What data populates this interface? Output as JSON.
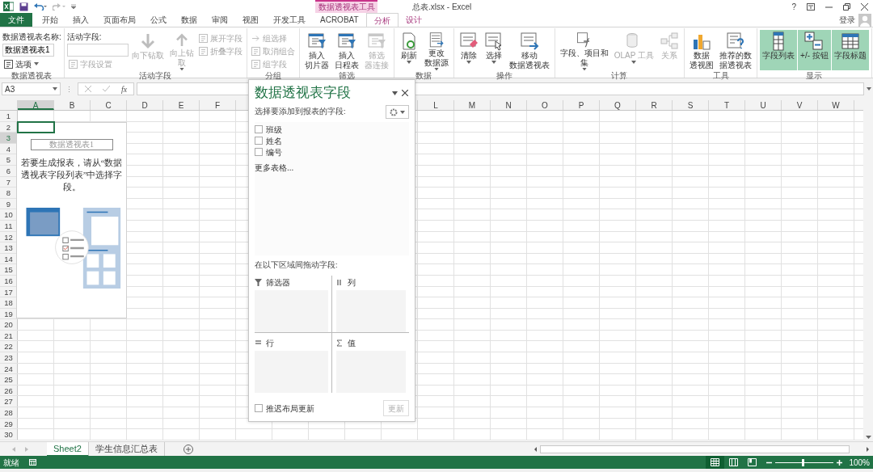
{
  "title_bar": {
    "title": "总表.xlsx - Excel",
    "context_label": "数据透视表工具",
    "help": "?",
    "sign_in": "登录"
  },
  "tabs": [
    {
      "label": "文件",
      "kind": "file",
      "selected": false
    },
    {
      "label": "开始",
      "kind": "normal",
      "selected": false
    },
    {
      "label": "插入",
      "kind": "normal",
      "selected": false
    },
    {
      "label": "页面布局",
      "kind": "normal",
      "selected": false
    },
    {
      "label": "公式",
      "kind": "normal",
      "selected": false
    },
    {
      "label": "数据",
      "kind": "normal",
      "selected": false
    },
    {
      "label": "审阅",
      "kind": "normal",
      "selected": false
    },
    {
      "label": "视图",
      "kind": "normal",
      "selected": false
    },
    {
      "label": "开发工具",
      "kind": "normal",
      "selected": false
    },
    {
      "label": "ACROBAT",
      "kind": "normal",
      "selected": false
    },
    {
      "label": "分析",
      "kind": "context",
      "selected": true
    },
    {
      "label": "设计",
      "kind": "context",
      "selected": false
    }
  ],
  "ribbon_groups": [
    {
      "label": "数据透视表",
      "field_label": "数据透视表名称:",
      "field_value": "数据透视表1",
      "buttons": [
        {
          "kind": "small",
          "lines": [
            "选项"
          ],
          "disabled": false,
          "dropdown": true,
          "on": false
        }
      ]
    },
    {
      "label": "活动字段",
      "field_label": "活动字段:",
      "buttons": [
        {
          "kind": "small",
          "lines": [
            "字段设置"
          ],
          "disabled": true,
          "dropdown": false,
          "on": false
        },
        {
          "kind": "large",
          "lines": [
            "向下钻取"
          ],
          "disabled": true,
          "dropdown": false,
          "on": false
        },
        {
          "kind": "large",
          "lines": [
            "向上钻",
            "取"
          ],
          "disabled": true,
          "dropdown": true,
          "on": false
        },
        {
          "kind": "small",
          "lines": [
            "展开字段"
          ],
          "disabled": true,
          "dropdown": false,
          "on": false
        },
        {
          "kind": "small",
          "lines": [
            "折叠字段"
          ],
          "disabled": true,
          "dropdown": false,
          "on": false
        }
      ]
    },
    {
      "label": "分组",
      "buttons": [
        {
          "kind": "small",
          "lines": [
            "组选择"
          ],
          "disabled": true,
          "dropdown": false,
          "on": false
        },
        {
          "kind": "small",
          "lines": [
            "取消组合"
          ],
          "disabled": true,
          "dropdown": false,
          "on": false
        },
        {
          "kind": "small",
          "lines": [
            "组字段"
          ],
          "disabled": true,
          "dropdown": false,
          "on": false
        }
      ]
    },
    {
      "label": "筛选",
      "buttons": [
        {
          "kind": "large",
          "lines": [
            "插入",
            "切片器"
          ],
          "disabled": false,
          "dropdown": false,
          "on": false
        },
        {
          "kind": "large",
          "lines": [
            "插入",
            "日程表"
          ],
          "disabled": false,
          "dropdown": false,
          "on": false
        },
        {
          "kind": "large",
          "lines": [
            "筛选",
            "器连接"
          ],
          "disabled": true,
          "dropdown": false,
          "on": false
        }
      ]
    },
    {
      "label": "数据",
      "buttons": [
        {
          "kind": "large",
          "lines": [
            "刷新"
          ],
          "disabled": false,
          "dropdown": true,
          "on": false
        },
        {
          "kind": "large",
          "lines": [
            "更改",
            "数据源"
          ],
          "disabled": false,
          "dropdown": true,
          "on": false
        }
      ]
    },
    {
      "label": "操作",
      "buttons": [
        {
          "kind": "large",
          "lines": [
            "清除"
          ],
          "disabled": false,
          "dropdown": true,
          "on": false
        },
        {
          "kind": "large",
          "lines": [
            "选择"
          ],
          "disabled": false,
          "dropdown": true,
          "on": false
        },
        {
          "kind": "large",
          "lines": [
            "移动",
            "数据透视表"
          ],
          "disabled": false,
          "dropdown": false,
          "on": false
        }
      ]
    },
    {
      "label": "计算",
      "buttons": [
        {
          "kind": "large",
          "lines": [
            "字段、项目和",
            "集"
          ],
          "disabled": false,
          "dropdown": true,
          "on": false
        },
        {
          "kind": "large",
          "lines": [
            "OLAP 工具"
          ],
          "disabled": true,
          "dropdown": true,
          "on": false
        },
        {
          "kind": "large",
          "lines": [
            "关系"
          ],
          "disabled": true,
          "dropdown": false,
          "on": false
        }
      ]
    },
    {
      "label": "工具",
      "buttons": [
        {
          "kind": "large",
          "lines": [
            "数据",
            "透视图"
          ],
          "disabled": false,
          "dropdown": false,
          "on": false
        },
        {
          "kind": "large",
          "lines": [
            "推荐的数",
            "据透视表"
          ],
          "disabled": false,
          "dropdown": false,
          "on": false
        }
      ]
    },
    {
      "label": "显示",
      "buttons": [
        {
          "kind": "large",
          "lines": [
            "字段列表"
          ],
          "disabled": false,
          "dropdown": false,
          "on": true
        },
        {
          "kind": "large",
          "lines": [
            "+/- 按钮"
          ],
          "disabled": false,
          "dropdown": false,
          "on": true
        },
        {
          "kind": "large",
          "lines": [
            "字段标题"
          ],
          "disabled": false,
          "dropdown": false,
          "on": true
        }
      ]
    }
  ],
  "formula_bar": {
    "name_box": "A3",
    "function_label": "fx"
  },
  "columns_left": [
    {
      "label": "A",
      "selected": true
    },
    {
      "label": "B",
      "selected": false
    },
    {
      "label": "C",
      "selected": false
    },
    {
      "label": "D",
      "selected": false
    },
    {
      "label": "E",
      "selected": false
    },
    {
      "label": "F",
      "selected": false
    }
  ],
  "columns_right": [
    {
      "label": "L",
      "selected": false
    },
    {
      "label": "M",
      "selected": false
    },
    {
      "label": "N",
      "selected": false
    },
    {
      "label": "O",
      "selected": false
    },
    {
      "label": "P",
      "selected": false
    },
    {
      "label": "Q",
      "selected": false
    },
    {
      "label": "R",
      "selected": false
    },
    {
      "label": "S",
      "selected": false
    },
    {
      "label": "T",
      "selected": false
    },
    {
      "label": "U",
      "selected": false
    },
    {
      "label": "V",
      "selected": false
    },
    {
      "label": "W",
      "selected": false
    }
  ],
  "rows": [
    {
      "label": "1",
      "selected": false
    },
    {
      "label": "2",
      "selected": false
    },
    {
      "label": "3",
      "selected": true
    },
    {
      "label": "4",
      "selected": false
    },
    {
      "label": "5",
      "selected": false
    },
    {
      "label": "6",
      "selected": false
    },
    {
      "label": "7",
      "selected": false
    },
    {
      "label": "8",
      "selected": false
    },
    {
      "label": "9",
      "selected": false
    },
    {
      "label": "10",
      "selected": false
    },
    {
      "label": "11",
      "selected": false
    },
    {
      "label": "12",
      "selected": false
    },
    {
      "label": "13",
      "selected": false
    },
    {
      "label": "14",
      "selected": false
    },
    {
      "label": "15",
      "selected": false
    },
    {
      "label": "16",
      "selected": false
    },
    {
      "label": "17",
      "selected": false
    },
    {
      "label": "18",
      "selected": false
    },
    {
      "label": "19",
      "selected": false
    },
    {
      "label": "20",
      "selected": false
    },
    {
      "label": "21",
      "selected": false
    },
    {
      "label": "22",
      "selected": false
    },
    {
      "label": "23",
      "selected": false
    },
    {
      "label": "24",
      "selected": false
    },
    {
      "label": "25",
      "selected": false
    },
    {
      "label": "26",
      "selected": false
    },
    {
      "label": "27",
      "selected": false
    },
    {
      "label": "28",
      "selected": false
    },
    {
      "label": "29",
      "selected": false
    },
    {
      "label": "30",
      "selected": false
    }
  ],
  "pivot_placeholder": {
    "title": "数据透视表1",
    "message": "若要生成报表，请从“数据透视表字段列表”中选择字段。"
  },
  "field_pane": {
    "title": "数据透视表字段",
    "choose_label": "选择要添加到报表的字段:",
    "fields": [
      {
        "label": "班级",
        "checked": false
      },
      {
        "label": "姓名",
        "checked": false
      },
      {
        "label": "编号",
        "checked": false
      }
    ],
    "more_tables": "更多表格...",
    "drag_label": "在以下区域间拖动字段:",
    "areas": [
      {
        "label": "筛选器",
        "kind": "filter"
      },
      {
        "label": "列",
        "kind": "columns"
      },
      {
        "label": "行",
        "kind": "rows"
      },
      {
        "label": "值",
        "kind": "values"
      }
    ],
    "defer": {
      "label": "推迟布局更新",
      "checked": false
    },
    "update_button": {
      "label": "更新",
      "disabled": true
    }
  },
  "sheet_tabs": [
    {
      "label": "Sheet2",
      "selected": true
    },
    {
      "label": "学生信息汇总表",
      "selected": false
    }
  ],
  "status_bar": {
    "status": "就绪",
    "views": [
      {
        "kind": "normal",
        "selected": true
      },
      {
        "kind": "page_layout",
        "selected": false
      },
      {
        "kind": "page_break",
        "selected": false
      }
    ],
    "zoom": {
      "level": 0.47,
      "reading": "100%"
    }
  }
}
